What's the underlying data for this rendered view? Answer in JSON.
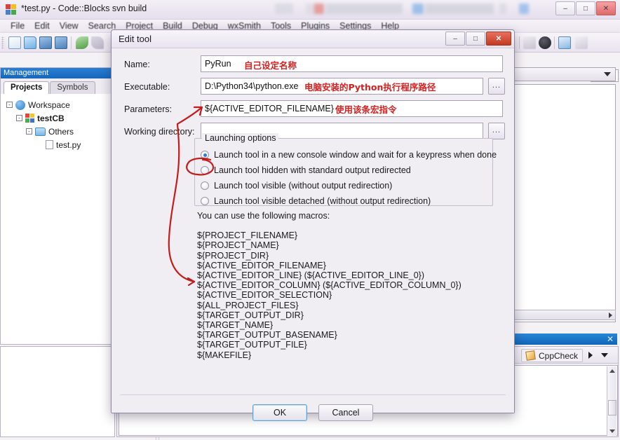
{
  "os": {
    "window_title": "*test.py - Code::Blocks svn build",
    "app_icon": "codeblocks-icon",
    "minimize": "–",
    "maximize": "□",
    "close": "✕"
  },
  "menubar": {
    "items": [
      "File",
      "Edit",
      "View",
      "Search",
      "Project",
      "Build",
      "Debug",
      "wxSmith",
      "Tools",
      "Plugins",
      "Settings",
      "Help"
    ]
  },
  "management": {
    "title": "Management",
    "tabs": [
      {
        "label": "Projects",
        "active": true
      },
      {
        "label": "Symbols",
        "active": false
      }
    ],
    "tree": [
      {
        "label": "Workspace",
        "icon": "workspace-icon",
        "depth": 0,
        "toggle": "-",
        "bold": false
      },
      {
        "label": "testCB",
        "icon": "codeblocks-project-icon",
        "depth": 1,
        "toggle": "-",
        "bold": true
      },
      {
        "label": "Others",
        "icon": "folder-icon",
        "depth": 2,
        "toggle": "-",
        "bold": false
      },
      {
        "label": "test.py",
        "icon": "file-icon",
        "depth": 3,
        "toggle": "",
        "bold": false
      }
    ]
  },
  "bottom_panel": {
    "tab_label": "CppCheck",
    "tab_icon": "pencil-icon",
    "close_label": "✕",
    "next_arrow": "▶",
    "dropdown_caret": "▼"
  },
  "dialog": {
    "title": "Edit tool",
    "minimize": "–",
    "maximize": "□",
    "close": "✕",
    "fields": [
      {
        "label": "Name:",
        "value": "PyRun",
        "placeholder": "",
        "browse": false,
        "annotation": "自己设定名称"
      },
      {
        "label": "Executable:",
        "value": "D:\\Python34\\python.exe",
        "placeholder": "",
        "browse": true,
        "annotation": "电脑安装的Python执行程序路径"
      },
      {
        "label": "Parameters:",
        "value": "${ACTIVE_EDITOR_FILENAME}",
        "placeholder": "",
        "browse": false,
        "annotation": "使用该条宏指令"
      },
      {
        "label": "Working directory:",
        "value": "",
        "placeholder": "",
        "browse": true,
        "annotation": ""
      }
    ],
    "browse_label": "...",
    "launching_options": {
      "legend": "Launching options",
      "options": [
        {
          "label": "Launch tool in a new console window and wait for a keypress when done",
          "selected": true
        },
        {
          "label": "Launch tool hidden with standard output redirected",
          "selected": false
        },
        {
          "label": "Launch tool visible (without output redirection)",
          "selected": false
        },
        {
          "label": "Launch tool visible detached (without output redirection)",
          "selected": false
        }
      ]
    },
    "macros_intro": "You can use the following macros:",
    "macros": [
      "${PROJECT_FILENAME}",
      "${PROJECT_NAME}",
      "${PROJECT_DIR}",
      "${ACTIVE_EDITOR_FILENAME}",
      "${ACTIVE_EDITOR_LINE} (${ACTIVE_EDITOR_LINE_0})",
      "${ACTIVE_EDITOR_COLUMN} (${ACTIVE_EDITOR_COLUMN_0})",
      "${ACTIVE_EDITOR_SELECTION}",
      "${ALL_PROJECT_FILES}",
      "${TARGET_OUTPUT_DIR}",
      "${TARGET_NAME}",
      "${TARGET_OUTPUT_BASENAME}",
      "${TARGET_OUTPUT_FILE}",
      "${MAKEFILE}"
    ],
    "ok_label": "OK",
    "cancel_label": "Cancel"
  },
  "colors": {
    "annotation_red": "#d61f1f",
    "title_blue": "#1567bb",
    "accent_close_red": "#c23a22",
    "selected_radio": "#2b7fd4"
  }
}
